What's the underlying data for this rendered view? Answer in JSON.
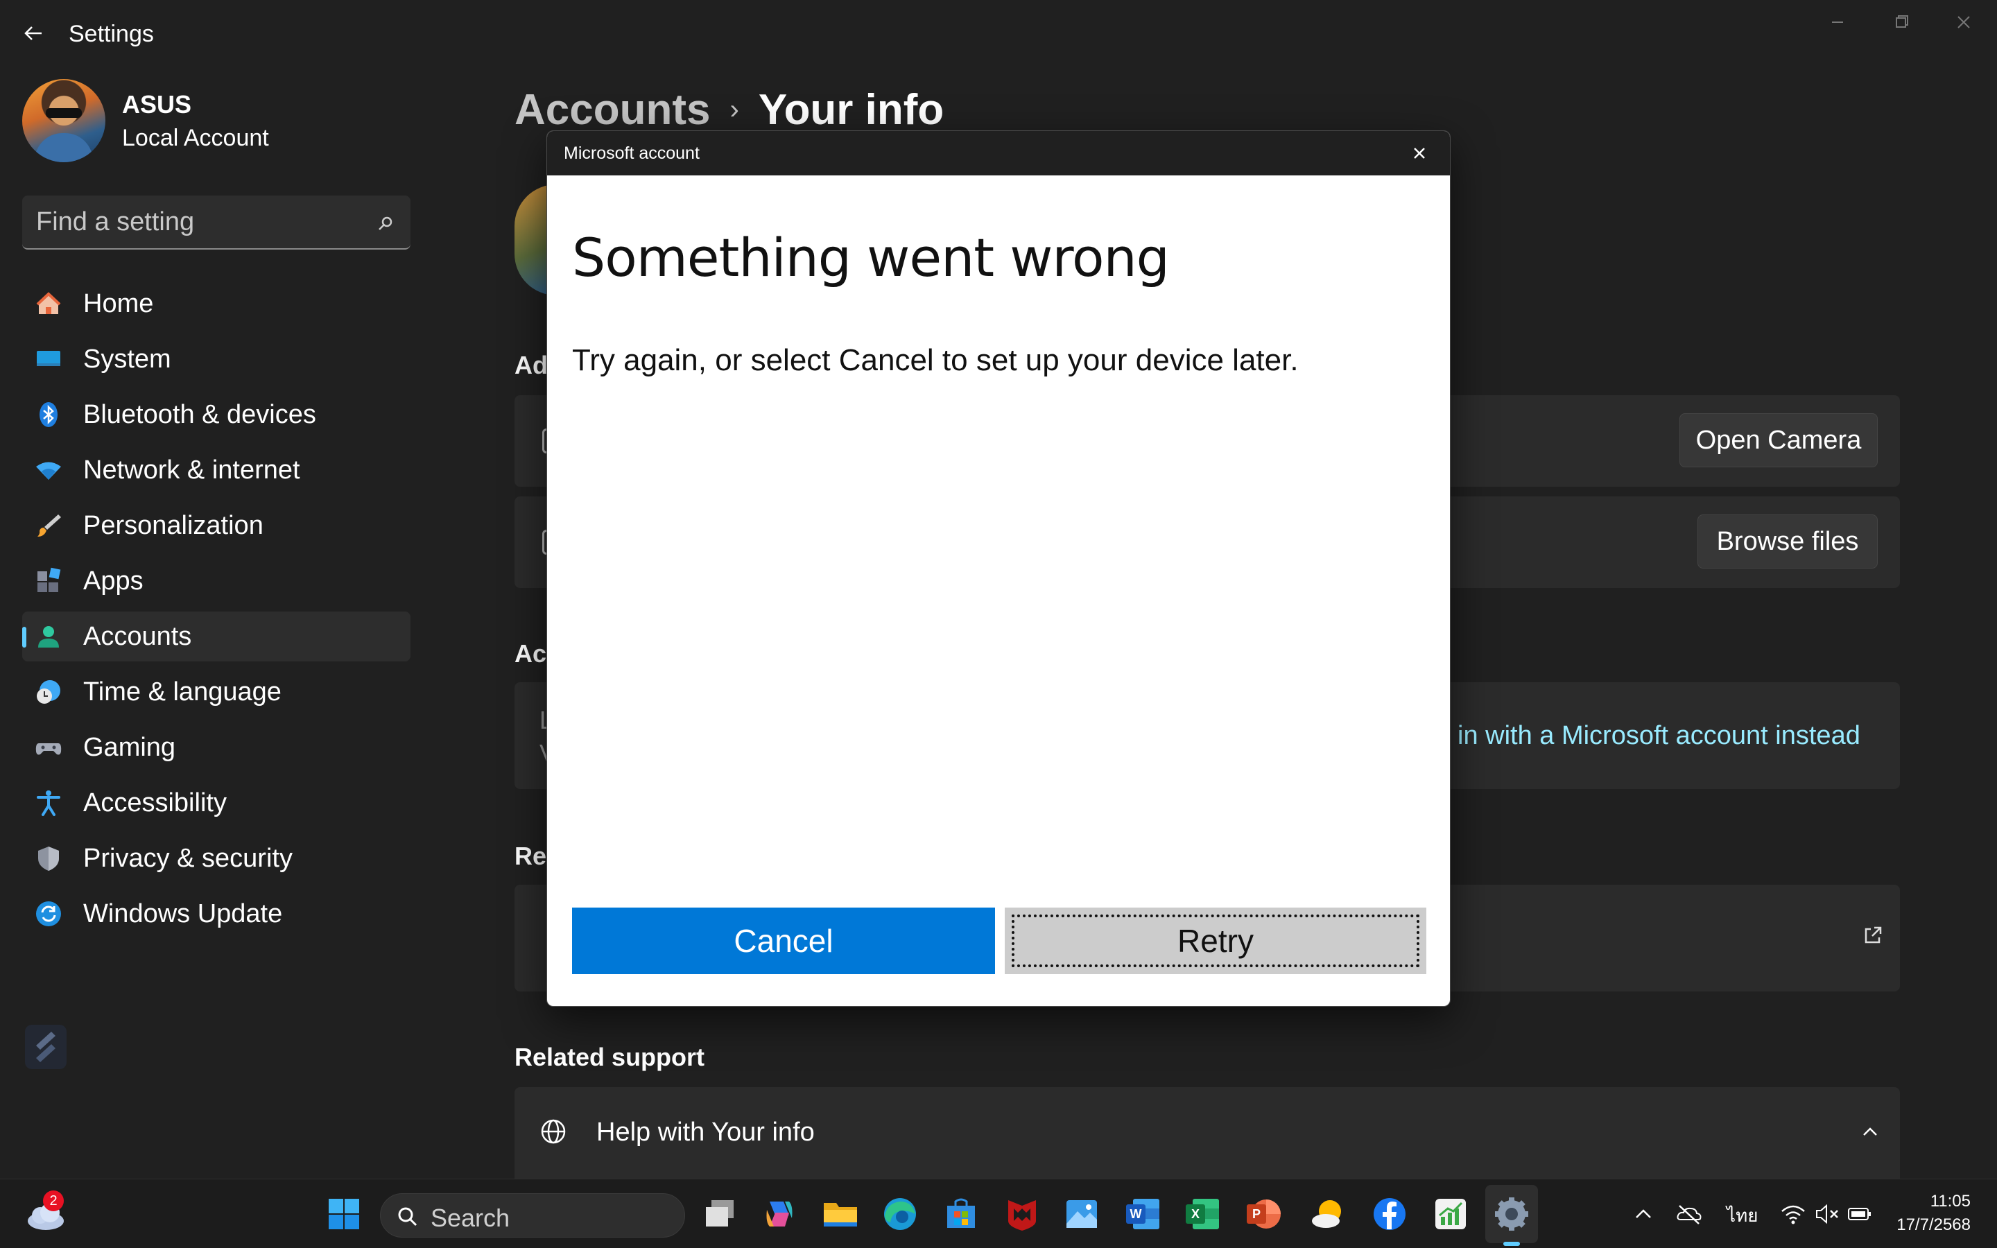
{
  "window": {
    "title": "Settings"
  },
  "profile": {
    "name": "ASUS",
    "account_type": "Local Account"
  },
  "search": {
    "placeholder": "Find a setting"
  },
  "sidebar": {
    "items": [
      {
        "label": "Home",
        "icon": "home-icon"
      },
      {
        "label": "System",
        "icon": "system-icon"
      },
      {
        "label": "Bluetooth & devices",
        "icon": "bluetooth-icon"
      },
      {
        "label": "Network & internet",
        "icon": "wifi-icon"
      },
      {
        "label": "Personalization",
        "icon": "brush-icon"
      },
      {
        "label": "Apps",
        "icon": "apps-icon"
      },
      {
        "label": "Accounts",
        "icon": "accounts-icon",
        "selected": true
      },
      {
        "label": "Time & language",
        "icon": "clock-globe-icon"
      },
      {
        "label": "Gaming",
        "icon": "gamepad-icon"
      },
      {
        "label": "Accessibility",
        "icon": "accessibility-icon"
      },
      {
        "label": "Privacy & security",
        "icon": "shield-icon"
      },
      {
        "label": "Windows Update",
        "icon": "update-icon"
      }
    ]
  },
  "breadcrumb": {
    "parent": "Accounts",
    "separator": "›",
    "current": "Your info"
  },
  "main": {
    "section_adjust_partial": "Ad",
    "open_camera_label": "Open Camera",
    "browse_files_label": "Browse files",
    "section_account_partial": "Ac",
    "account_row_partial_1": "L",
    "account_row_partial_2": "V",
    "sign_in_link_partial": "in with a Microsoft account instead",
    "section_related_partial": "Re",
    "related_support_heading": "Related support",
    "help_label": "Help with Your info"
  },
  "dialog": {
    "title": "Microsoft account",
    "heading": "Something went wrong",
    "message": "Try again, or select Cancel to set up your device later.",
    "cancel_label": "Cancel",
    "retry_label": "Retry"
  },
  "taskbar": {
    "search_label": "Search",
    "weather_badge": "2",
    "language": "ไทย",
    "time": "11:05",
    "date": "17/7/2568",
    "pinned": [
      "task-view-icon",
      "copilot-icon",
      "file-explorer-icon",
      "edge-icon",
      "store-icon",
      "mcafee-icon",
      "photos-icon",
      "word-icon",
      "excel-icon",
      "powerpoint-icon",
      "weather-app-icon",
      "facebook-icon",
      "stocks-app-icon",
      "settings-app-icon"
    ]
  },
  "colors": {
    "accent": "#60cdff",
    "cancel_button": "#0078d7",
    "link": "#99ebff",
    "background": "#202020"
  }
}
